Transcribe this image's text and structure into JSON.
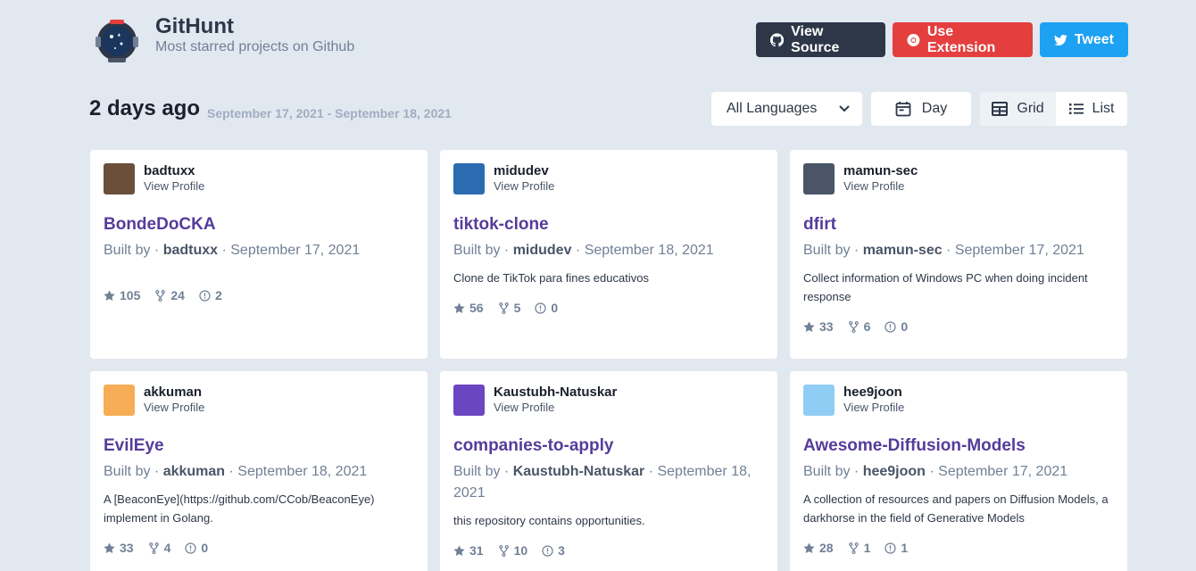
{
  "brand": {
    "title": "GitHunt",
    "subtitle": "Most starred projects on Github"
  },
  "header_buttons": {
    "view_source": "View Source",
    "use_extension": "Use Extension",
    "tweet": "Tweet"
  },
  "toolbar": {
    "heading": "2 days ago",
    "date_range": "September 17, 2021 - September 18, 2021",
    "language": "All Languages",
    "period": "Day",
    "grid": "Grid",
    "list": "List"
  },
  "colors": {
    "source": "#2d3748",
    "extension": "#e53e3e",
    "tweet": "#1da1f2",
    "repo_link": "#553c9a"
  },
  "built_by_prefix": "Built by · ",
  "view_profile": "View Profile",
  "repos": [
    {
      "user": "badtuxx",
      "name": "BondeDoCKA",
      "date": "September 17, 2021",
      "desc": "",
      "stars": "105",
      "forks": "24",
      "issues": "2",
      "avatar_bg": "#6b4f3a"
    },
    {
      "user": "midudev",
      "name": "tiktok-clone",
      "date": "September 18, 2021",
      "desc": "Clone de TikTok para fines educativos",
      "stars": "56",
      "forks": "5",
      "issues": "0",
      "avatar_bg": "#2b6cb0"
    },
    {
      "user": "mamun-sec",
      "name": "dfirt",
      "date": "September 17, 2021",
      "desc": "Collect information of Windows PC when doing incident response",
      "stars": "33",
      "forks": "6",
      "issues": "0",
      "avatar_bg": "#4a5568"
    },
    {
      "user": "akkuman",
      "name": "EvilEye",
      "date": "September 18, 2021",
      "desc": "A [BeaconEye](https://github.com/CCob/BeaconEye) implement in Golang.",
      "stars": "33",
      "forks": "4",
      "issues": "0",
      "avatar_bg": "#f6ad55"
    },
    {
      "user": "Kaustubh-Natuskar",
      "name": "companies-to-apply",
      "date": "September 18, 2021",
      "desc": "this repository contains opportunities.",
      "stars": "31",
      "forks": "10",
      "issues": "3",
      "avatar_bg": "#6b46c1"
    },
    {
      "user": "hee9joon",
      "name": "Awesome-Diffusion-Models",
      "date": "September 17, 2021",
      "desc": "A collection of resources and papers on Diffusion Models, a darkhorse in the field of Generative Models",
      "stars": "28",
      "forks": "1",
      "issues": "1",
      "avatar_bg": "#90cdf4"
    }
  ]
}
